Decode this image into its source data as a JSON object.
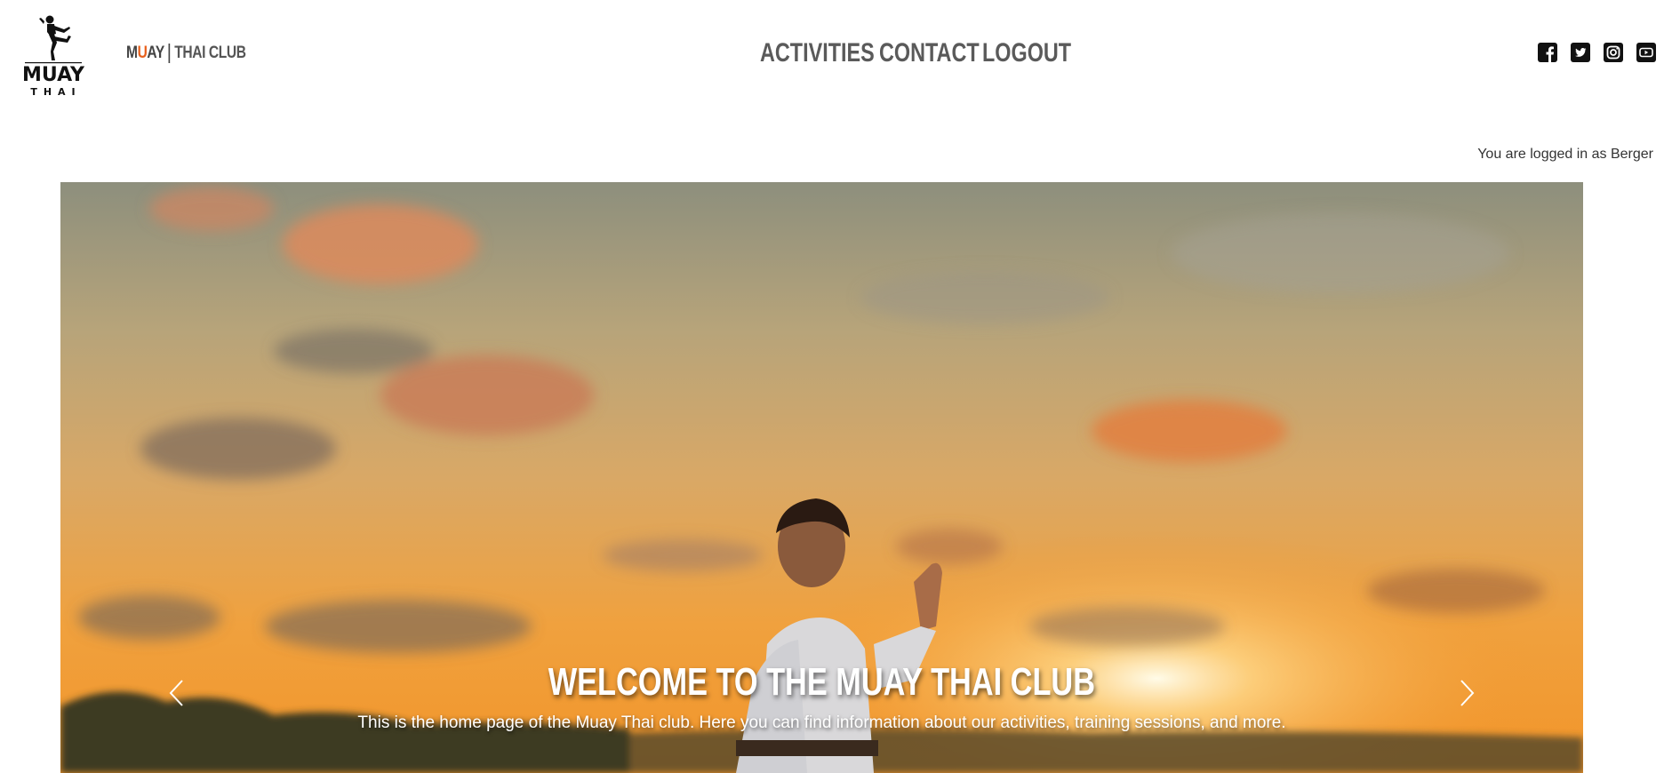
{
  "brand": {
    "logo_text_top": "MUAY",
    "logo_text_bottom": "THAI",
    "name_m": "M",
    "name_u": "U",
    "name_ay": "AY",
    "name_club": "THAI CLUB",
    "accent_color": "#e8601c"
  },
  "nav": {
    "items": [
      {
        "label": "ACTIVITIES"
      },
      {
        "label": "CONTACT"
      },
      {
        "label": "LOGOUT"
      }
    ]
  },
  "social": {
    "icons": [
      "facebook-icon",
      "twitter-icon",
      "instagram-icon",
      "youtube-icon"
    ]
  },
  "session": {
    "status": "You are logged in as Berger"
  },
  "hero": {
    "title": "WELCOME TO THE MUAY THAI CLUB",
    "text": "This is the home page of the Muay Thai club. Here you can find information about our activities, training sessions, and more."
  }
}
